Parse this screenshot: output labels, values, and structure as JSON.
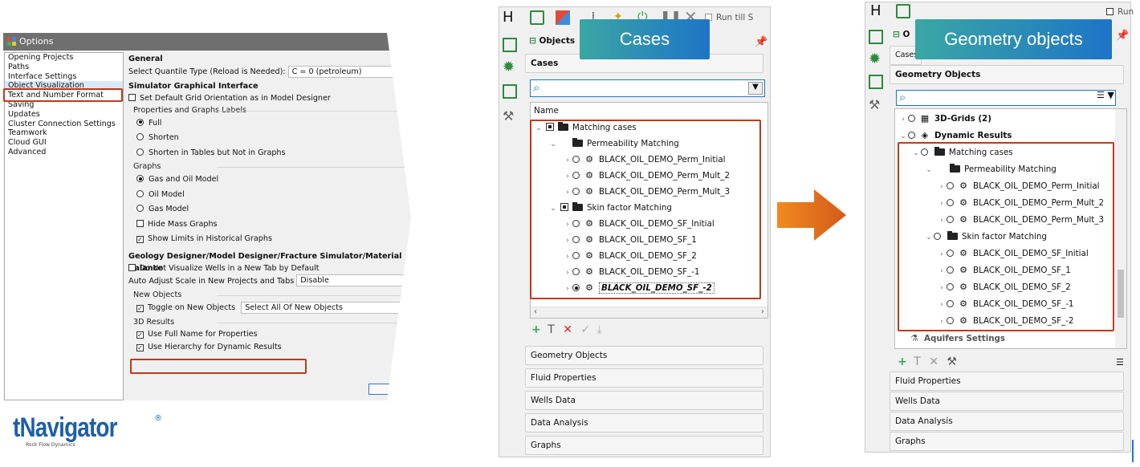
{
  "options": {
    "title": "Options",
    "sidebar": [
      "Opening Projects",
      "Paths",
      "Interface Settings",
      "Object Visualization",
      "Text and Number Format",
      "Saving",
      "Updates",
      "Cluster Connection Settings",
      "Teamwork",
      "Cloud GUI",
      "Advanced"
    ],
    "general_header": "General",
    "quantile_label": "Select Quantile Type (Reload is Needed):",
    "quantile_value": "C = 0 (petroleum)",
    "sim_header": "Simulator Graphical Interface",
    "default_grid": "Set Default Grid Orientation as in Model Designer",
    "labels_group": "Properties and Graphs Labels",
    "opt_full": "Full",
    "opt_shorten": "Shorten",
    "opt_shorten_tables": "Shorten in Tables but Not in Graphs",
    "graphs_group": "Graphs",
    "opt_gas_oil": "Gas and Oil Model",
    "opt_oil": "Oil Model",
    "opt_gas": "Gas Model",
    "hide_mass": "Hide Mass Graphs",
    "show_limits": "Show Limits in Historical Graphs",
    "geo_header": "Geology Designer/Model Designer/Fracture Simulator/Material Balance",
    "no_wells_tab": "Do Not Visualize Wells in a New Tab by Default",
    "auto_adjust_label": "Auto Adjust Scale in New Projects and Tabs",
    "auto_adjust_value": "Disable",
    "new_objects_group": "New Objects",
    "toggle_new": "Toggle on New Objects",
    "toggle_new_value": "Select All Of New Objects",
    "results3d_group": "3D Results",
    "full_name": "Use Full Name for Properties",
    "hierarchy": "Use Hierarchy for Dynamic Results"
  },
  "logo": {
    "text": "tNavigator",
    "sub": "Rock Flow Dynamics",
    "reg": "®"
  },
  "middle": {
    "callout": "Cases",
    "run_till": "Run till S",
    "objects_title": "Objects",
    "cases_section": "Cases",
    "name_header": "Name",
    "root": "Matching cases",
    "group1": "Permeability Matching",
    "group1_items": [
      "BLACK_OIL_DEMO_Perm_Initial",
      "BLACK_OIL_DEMO_Perm_Mult_2",
      "BLACK_OIL_DEMO_Perm_Mult_3"
    ],
    "group2": "Skin factor Matching",
    "group2_items": [
      "BLACK_OIL_DEMO_SF_Initial",
      "BLACK_OIL_DEMO_SF_1",
      "BLACK_OIL_DEMO_SF_2",
      "BLACK_OIL_DEMO_SF_-1"
    ],
    "selected_item": "BLACK_OIL_DEMO_SF_-2",
    "sections": [
      "Geometry Objects",
      "Fluid Properties",
      "Wells Data",
      "Data Analysis",
      "Graphs"
    ]
  },
  "right": {
    "callout": "Geometry objects",
    "run_till": "Run",
    "objects_title": "O",
    "cases_section": "Cases",
    "geometry_section": "Geometry Objects",
    "grids": "3D-Grids (2)",
    "dynamic": "Dynamic Results",
    "root": "Matching cases",
    "group1": "Permeability Matching",
    "group1_items": [
      "BLACK_OIL_DEMO_Perm_Initial",
      "BLACK_OIL_DEMO_Perm_Mult_2",
      "BLACK_OIL_DEMO_Perm_Mult_3"
    ],
    "group2": "Skin factor Matching",
    "group2_items": [
      "BLACK_OIL_DEMO_SF_Initial",
      "BLACK_OIL_DEMO_SF_1",
      "BLACK_OIL_DEMO_SF_2",
      "BLACK_OIL_DEMO_SF_-1",
      "BLACK_OIL_DEMO_SF_-2"
    ],
    "aquifers": "Aquifers Settings",
    "sections": [
      "Fluid Properties",
      "Wells Data",
      "Data Analysis",
      "Graphs"
    ]
  },
  "colors": {
    "highlight": "#c0391b",
    "arrow": "#e8761c",
    "callout_start": "#3aa7a4",
    "callout_end": "#1e74c7"
  }
}
